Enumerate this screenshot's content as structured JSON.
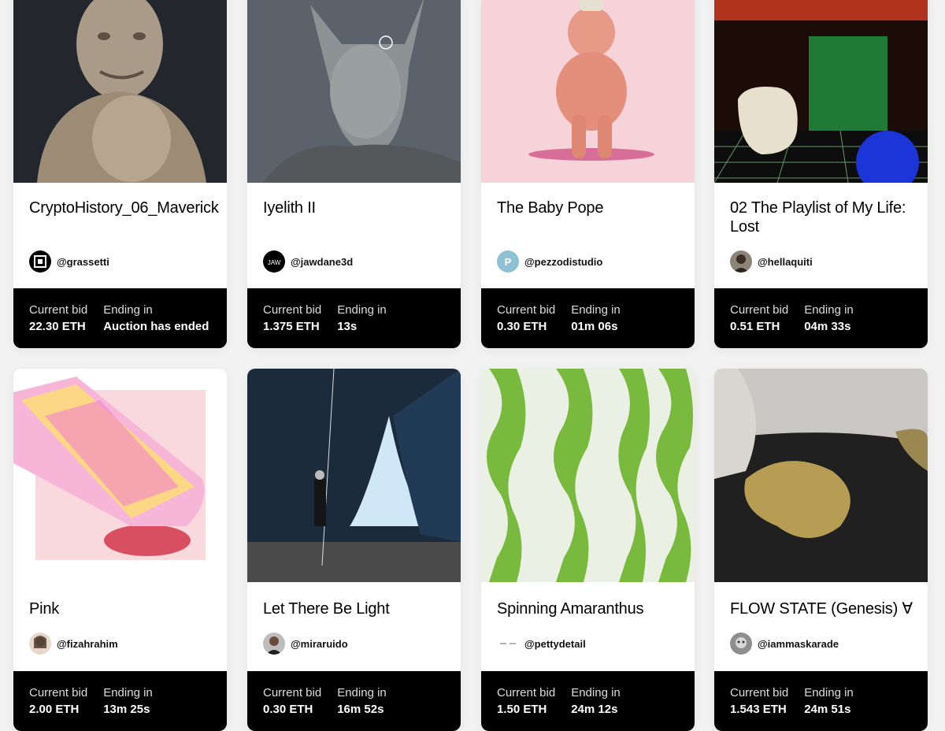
{
  "labels": {
    "current_bid": "Current bid",
    "ending_in": "Ending in"
  },
  "cards": [
    {
      "title": "CryptoHistory_06_Maverick",
      "creator": "@grassetti",
      "bid": "22.30 ETH",
      "ending": "Auction has ended"
    },
    {
      "title": "Iyelith II",
      "creator": "@jawdane3d",
      "bid": "1.375 ETH",
      "ending": "13s"
    },
    {
      "title": "The Baby Pope",
      "creator": "@pezzodistudio",
      "bid": "0.30 ETH",
      "ending": "01m  06s"
    },
    {
      "title": "02 The Playlist of My Life: Lost",
      "creator": "@hellaquiti",
      "bid": "0.51 ETH",
      "ending": "04m 33s"
    },
    {
      "title": "Pink",
      "creator": "@fizahrahim",
      "bid": "2.00 ETH",
      "ending": "13m  25s"
    },
    {
      "title": "Let There Be Light",
      "creator": "@miraruido",
      "bid": "0.30 ETH",
      "ending": "16m  52s"
    },
    {
      "title": "Spinning Amaranthus",
      "creator": "@pettydetail",
      "bid": "1.50 ETH",
      "ending": "24m  12s"
    },
    {
      "title": "FLOW STATE (Genesis) ∀",
      "creator": "@iammaskarade",
      "bid": "1.543 ETH",
      "ending": "24m  51s"
    }
  ]
}
